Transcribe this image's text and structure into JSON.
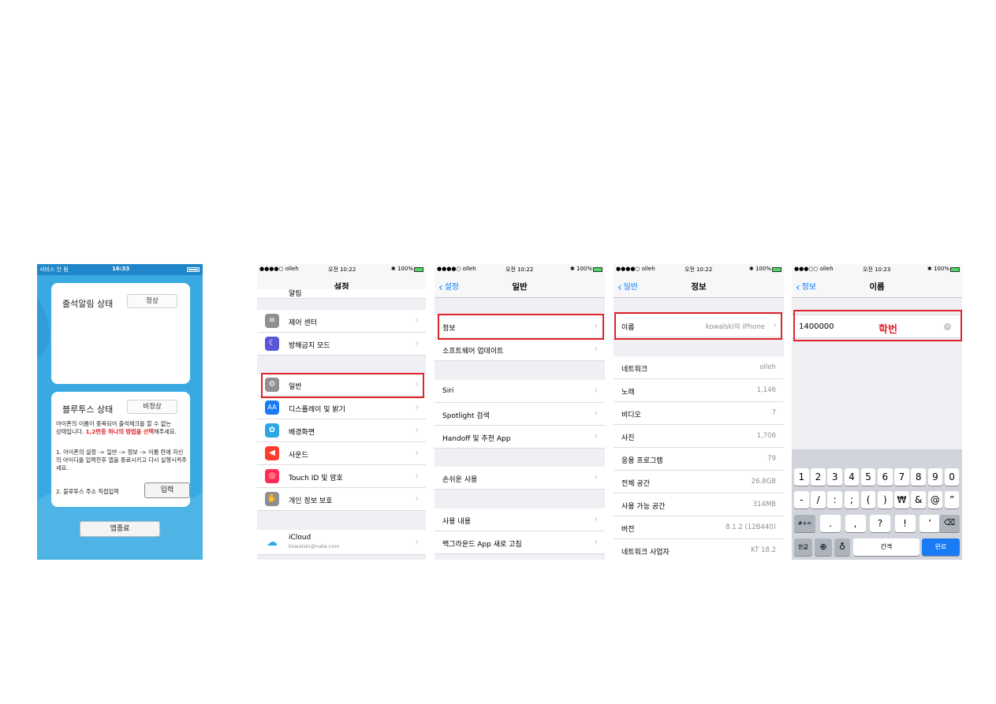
{
  "app_screen": {
    "status": {
      "carrier": "서비스 안 됨",
      "time": "16:33"
    },
    "attendance": {
      "title": "출석알림 상태",
      "status": "정상"
    },
    "bluetooth": {
      "title": "블루투스 상태",
      "status": "비정상"
    },
    "notice_line1": "아이폰의 이름이 중복되어 출석체크를 할 수 없는",
    "notice_line2_pre": "상태입니다. ",
    "notice_line2_red": "1,2번중 하나의 방법을 선택",
    "notice_line2_post": "해주세요.",
    "step1": "1. 아이폰의 설정 -> 일반 -> 정보 -> 이름 란에 자신의 아이디를 입력한후 앱을 종료시키고 다시 실행시켜주세요.",
    "step2_label": "2. 블루투스 주소 직접입력",
    "input_button": "입력",
    "exit_button": "앱종료",
    "colors": {
      "background": "#3aa9e2",
      "highlight": "#e0242b"
    }
  },
  "settings_screen": {
    "status": {
      "carrier": "●●●●○ olleh",
      "time": "오전 10:22",
      "right": "✱ 100%"
    },
    "title": "설정",
    "rows": [
      {
        "label": "알림",
        "icon": "notification-icon"
      },
      {
        "label": "제어 센터",
        "icon": "control-center-icon"
      },
      {
        "label": "방해금지 모드",
        "icon": "moon-icon"
      },
      {
        "label": "일반",
        "icon": "gear-icon"
      },
      {
        "label": "디스플레이 및 밝기",
        "icon": "display-icon"
      },
      {
        "label": "배경화면",
        "icon": "wallpaper-icon"
      },
      {
        "label": "사운드",
        "icon": "sound-icon"
      },
      {
        "label": "Touch ID 및 암호",
        "icon": "fingerprint-icon"
      },
      {
        "label": "개인 정보 보호",
        "icon": "hand-icon"
      },
      {
        "label": "iCloud",
        "sub": "kowalski@nate.com",
        "icon": "cloud-icon"
      }
    ]
  },
  "general_screen": {
    "status": {
      "carrier": "●●●●○ olleh",
      "time": "오전 10:22",
      "right": "✱ 100%"
    },
    "back": "설정",
    "title": "일반",
    "rows": [
      "정보",
      "소프트웨어 업데이트",
      "Siri",
      "Spotlight 검색",
      "Handoff 및 추천 App",
      "손쉬운 사용",
      "사용 내용",
      "백그라운드 App 새로 고침"
    ]
  },
  "about_screen": {
    "status": {
      "carrier": "●●●●○ olleh",
      "time": "오전 10:22",
      "right": "✱ 100%"
    },
    "back": "일반",
    "title": "정보",
    "name_row": {
      "label": "이름",
      "value": "kowalski의 iPhone"
    },
    "rows": [
      {
        "label": "네트워크",
        "value": "olleh"
      },
      {
        "label": "노래",
        "value": "1,146"
      },
      {
        "label": "비디오",
        "value": "7"
      },
      {
        "label": "사진",
        "value": "1,706"
      },
      {
        "label": "응용 프로그램",
        "value": "79"
      },
      {
        "label": "전체 공간",
        "value": "26.8GB"
      },
      {
        "label": "사용 가능 공간",
        "value": "314MB"
      },
      {
        "label": "버전",
        "value": "8.1.2 (12B440)"
      },
      {
        "label": "네트워크 사업자",
        "value": "KT 18.2"
      }
    ]
  },
  "name_screen": {
    "status": {
      "carrier": "●●●○○ olleh",
      "time": "오전 10:23",
      "right": "✱ 100%"
    },
    "back": "정보",
    "title": "이름",
    "field_value": "1400000",
    "field_annotation": "학번",
    "keyboard": {
      "row1": [
        "1",
        "2",
        "3",
        "4",
        "5",
        "6",
        "7",
        "8",
        "9",
        "0"
      ],
      "row2": [
        "-",
        "/",
        ":",
        ";",
        "(",
        ")",
        "₩",
        "&",
        "@",
        "”"
      ],
      "row3_left": "#+=",
      "row3": [
        ".",
        ",",
        "?",
        "!",
        "’"
      ],
      "row4": {
        "lang": "한글",
        "space": "간격",
        "done": "완료"
      }
    }
  }
}
